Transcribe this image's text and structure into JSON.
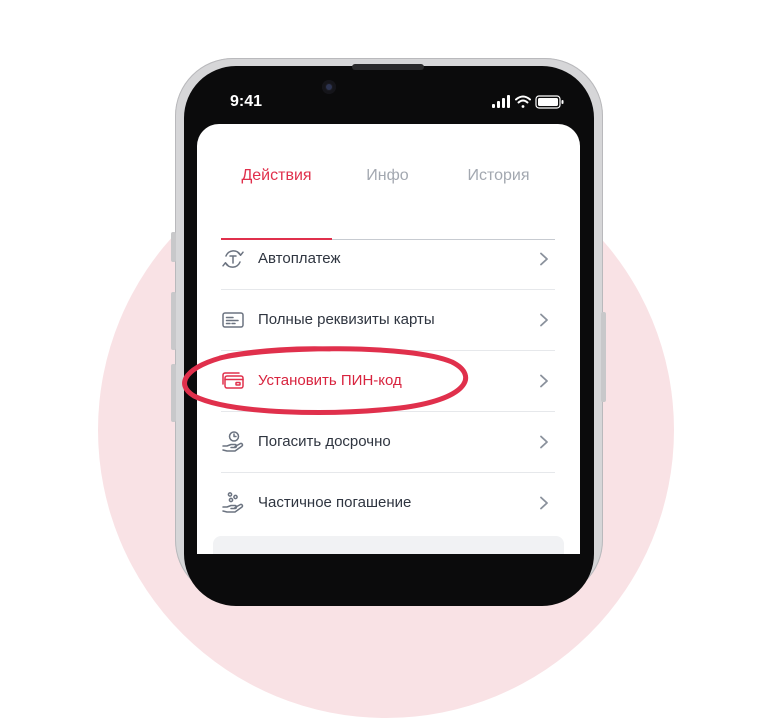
{
  "status_bar": {
    "time": "9:41"
  },
  "tabs": [
    {
      "label": "Действия",
      "active": true
    },
    {
      "label": "Инфо",
      "active": false
    },
    {
      "label": "История",
      "active": false
    }
  ],
  "actions": [
    {
      "label": "Автоплатеж",
      "icon": "autopay-icon"
    },
    {
      "label": "Полные реквизиты карты",
      "icon": "card-details-icon"
    },
    {
      "label": "Установить ПИН-код",
      "icon": "set-pin-card-icon",
      "highlighted": true
    },
    {
      "label": "Погасить досрочно",
      "icon": "early-repayment-icon"
    },
    {
      "label": "Частичное погашение",
      "icon": "partial-repayment-icon"
    }
  ],
  "colors": {
    "accent": "#e0304c",
    "background_circle": "#f9e2e5",
    "text": "#2f3540",
    "inactive_tab": "#a3a8b0"
  }
}
